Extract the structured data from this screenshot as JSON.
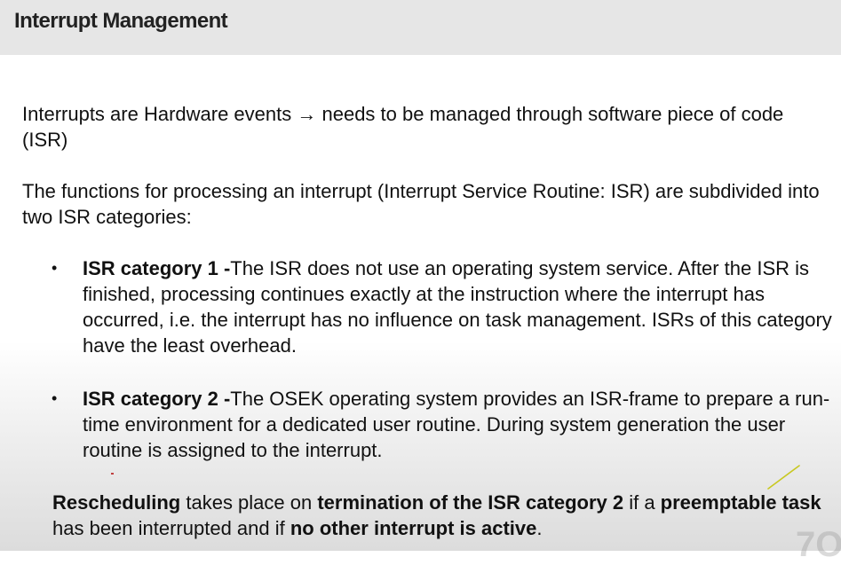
{
  "slide": {
    "title": "Interrupt Management",
    "intro": {
      "part1": "Interrupts are Hardware events ",
      "arrow": "→",
      "part2": " needs to be managed through software piece of code (ISR)"
    },
    "functions_text": "The functions for processing an interrupt (Interrupt Service Routine: ISR) are subdivided into two ISR categories:",
    "bullets": [
      {
        "marker": "•",
        "title": "ISR category 1 -",
        "text": "The ISR does not use an operating system service. After the ISR is finished, processing continues exactly at the instruction where the interrupt has occurred, i.e. the interrupt has no influence on task management. ISRs of this category have the least overhead."
      },
      {
        "marker": "•",
        "title": "ISR category 2 -",
        "text": "The OSEK operating system provides an ISR-frame to prepare a run-time environment for a dedicated user routine. During system generation the user routine is assigned to the interrupt."
      }
    ],
    "closing": {
      "b1": "Rescheduling",
      "t1": " takes place on ",
      "b2": "termination of the ISR category 2",
      "t2": " if a ",
      "b3": "preemptable task",
      "t3": " has been interrupted and if ",
      "b4": "no other interrupt is active",
      "t4": "."
    },
    "watermark": "7O"
  },
  "colors": {
    "title_bar": "#e6e6e6",
    "text": "#111111",
    "pen_mark": "#c8c820"
  }
}
